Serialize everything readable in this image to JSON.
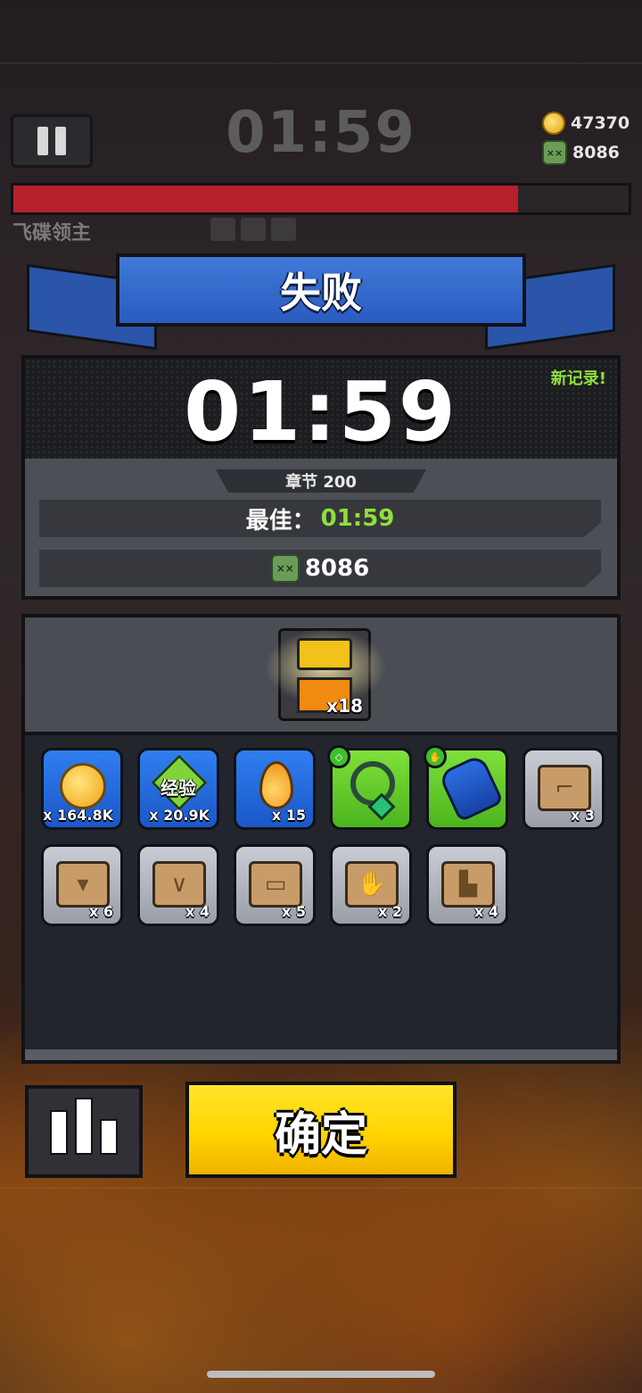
{
  "hud": {
    "timer": "01:59",
    "coins": "47370",
    "kills": "8086",
    "boss_name": "飞碟领主",
    "boss_health_fraction": 0.82
  },
  "result": {
    "title": "失败",
    "time": "01:59",
    "new_record": "新记录!",
    "chapter": "章节 200",
    "best_label": "最佳：",
    "best_value": "01:59",
    "kills": "8086"
  },
  "rewards": {
    "chest_count": "x18",
    "items": [
      {
        "name": "coin",
        "qty": "x 164.8K",
        "frame": "blue"
      },
      {
        "name": "exp",
        "label": "经验",
        "qty": "x 20.9K",
        "frame": "blue"
      },
      {
        "name": "fuel-drop",
        "qty": "x 15",
        "frame": "blue"
      },
      {
        "name": "necklace",
        "qty": "",
        "frame": "green"
      },
      {
        "name": "glove",
        "qty": "",
        "frame": "green"
      },
      {
        "name": "scroll-weapon",
        "qty": "x 3",
        "frame": "gray"
      },
      {
        "name": "scroll-armor",
        "qty": "x 6",
        "frame": "gray"
      },
      {
        "name": "scroll-necklace",
        "qty": "x 4",
        "frame": "gray"
      },
      {
        "name": "scroll-belt",
        "qty": "x 5",
        "frame": "gray"
      },
      {
        "name": "scroll-glove",
        "qty": "x 2",
        "frame": "gray"
      },
      {
        "name": "scroll-boots",
        "qty": "x 4",
        "frame": "gray"
      }
    ]
  },
  "buttons": {
    "confirm": "确定"
  },
  "colors": {
    "banner_blue": "#2a5bbf",
    "record_green": "#8ee03a",
    "confirm_yellow": "#ffd400",
    "boss_red": "#b8202c"
  }
}
